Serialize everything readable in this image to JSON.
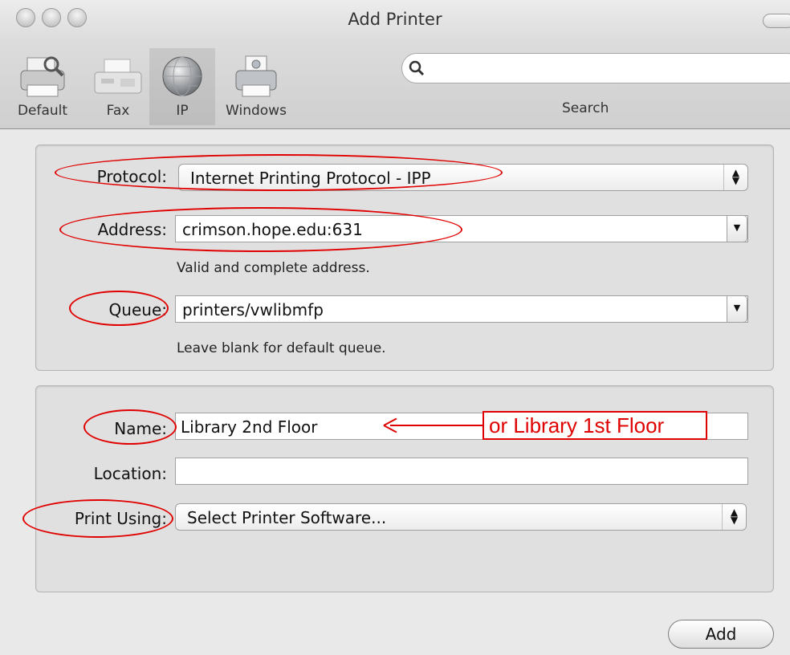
{
  "window": {
    "title": "Add Printer"
  },
  "toolbar": {
    "items": [
      {
        "label": "Default",
        "icon": "default-printer-icon"
      },
      {
        "label": "Fax",
        "icon": "fax-icon"
      },
      {
        "label": "IP",
        "icon": "ip-globe-icon",
        "selected": true
      },
      {
        "label": "Windows",
        "icon": "windows-printer-icon"
      }
    ],
    "search": {
      "label": "Search",
      "value": ""
    }
  },
  "connection": {
    "protocol_label": "Protocol:",
    "protocol_value": "Internet Printing Protocol - IPP",
    "address_label": "Address:",
    "address_value": "crimson.hope.edu:631",
    "address_hint": "Valid and complete address.",
    "queue_label": "Queue:",
    "queue_value": "printers/vwlibmfp",
    "queue_hint": "Leave blank for default queue."
  },
  "details": {
    "name_label": "Name:",
    "name_value": "Library 2nd Floor",
    "location_label": "Location:",
    "location_value": "",
    "print_using_label": "Print Using:",
    "print_using_value": "Select Printer Software..."
  },
  "annotation": {
    "callout_text": "or Library 1st Floor",
    "color": "#e00000"
  },
  "actions": {
    "add_label": "Add"
  }
}
